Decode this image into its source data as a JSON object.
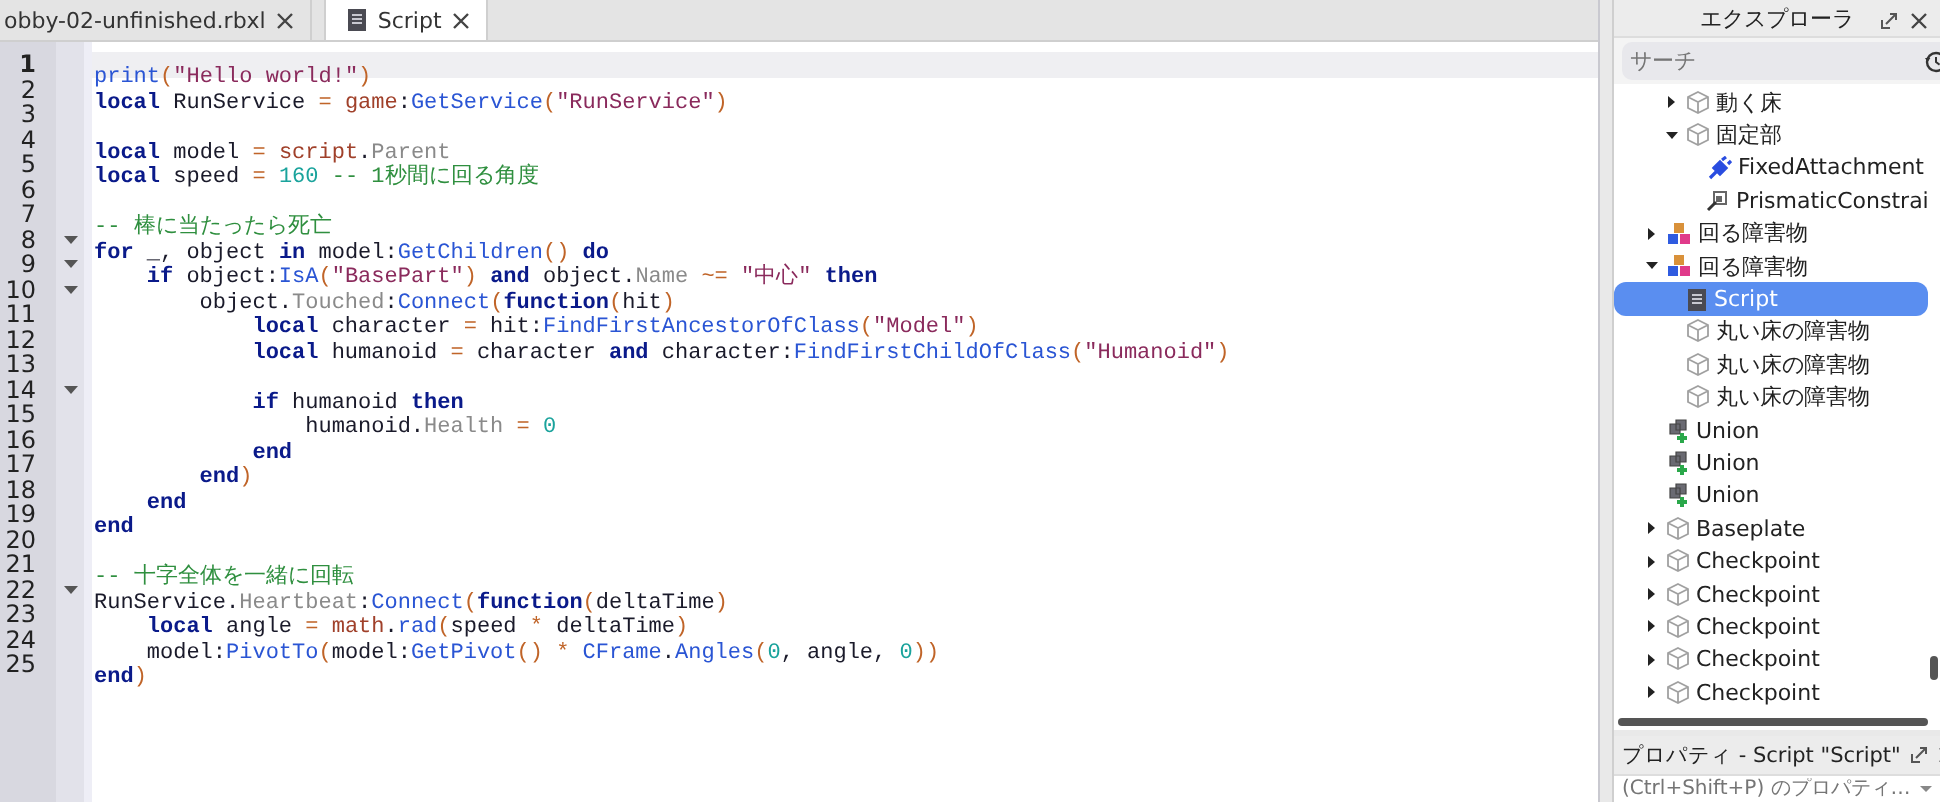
{
  "tabs": [
    {
      "label": "obby-02-unfinished.rbxl",
      "kind": "place",
      "selected": false
    },
    {
      "label": "Script",
      "kind": "script",
      "selected": true
    }
  ],
  "code": {
    "lines": [
      {
        "number": "1",
        "fold": false,
        "current": true,
        "tokens": [
          {
            "kind": "fn",
            "text": "print"
          },
          {
            "kind": "op",
            "text": "("
          },
          {
            "kind": "str",
            "text": "\"Hello world!\""
          },
          {
            "kind": "op",
            "text": ")"
          }
        ]
      },
      {
        "number": "2",
        "fold": false,
        "current": false,
        "tokens": [
          {
            "kind": "kw",
            "text": "local"
          },
          {
            "kind": "pl",
            "text": " RunService "
          },
          {
            "kind": "op",
            "text": "= "
          },
          {
            "kind": "bi",
            "text": "game"
          },
          {
            "kind": "pl",
            "text": ":"
          },
          {
            "kind": "fn",
            "text": "GetService"
          },
          {
            "kind": "op",
            "text": "("
          },
          {
            "kind": "str",
            "text": "\"RunService\""
          },
          {
            "kind": "op",
            "text": ")"
          }
        ]
      },
      {
        "number": "3",
        "fold": false,
        "current": false
      },
      {
        "number": "4",
        "fold": false,
        "current": false,
        "tokens": [
          {
            "kind": "kw",
            "text": "local"
          },
          {
            "kind": "pl",
            "text": " model "
          },
          {
            "kind": "op",
            "text": "= "
          },
          {
            "kind": "bi",
            "text": "script"
          },
          {
            "kind": "pl",
            "text": "."
          },
          {
            "kind": "prop",
            "text": "Parent"
          }
        ]
      },
      {
        "number": "5",
        "fold": false,
        "current": false,
        "tokens": [
          {
            "kind": "kw",
            "text": "local"
          },
          {
            "kind": "pl",
            "text": " speed "
          },
          {
            "kind": "op",
            "text": "= "
          },
          {
            "kind": "num",
            "text": "160"
          },
          {
            "kind": "com",
            "text": " -- 1秒間に回る角度"
          }
        ]
      },
      {
        "number": "6",
        "fold": false,
        "current": false
      },
      {
        "number": "7",
        "fold": false,
        "current": false,
        "tokens": [
          {
            "kind": "com",
            "text": "-- 棒に当たったら死亡"
          }
        ]
      },
      {
        "number": "8",
        "fold": true,
        "current": false,
        "tokens": [
          {
            "kind": "kw",
            "text": "for"
          },
          {
            "kind": "pl",
            "text": " _, object "
          },
          {
            "kind": "kw",
            "text": "in"
          },
          {
            "kind": "pl",
            "text": " model:"
          },
          {
            "kind": "fn",
            "text": "GetChildren"
          },
          {
            "kind": "op",
            "text": "() "
          },
          {
            "kind": "kw",
            "text": "do"
          }
        ]
      },
      {
        "number": "9",
        "fold": true,
        "current": false,
        "tokens": [
          {
            "kind": "kw",
            "text": "    if"
          },
          {
            "kind": "pl",
            "text": " object:"
          },
          {
            "kind": "fn",
            "text": "IsA"
          },
          {
            "kind": "op",
            "text": "("
          },
          {
            "kind": "str",
            "text": "\"BasePart\""
          },
          {
            "kind": "op",
            "text": ") "
          },
          {
            "kind": "kw",
            "text": "and"
          },
          {
            "kind": "pl",
            "text": " object."
          },
          {
            "kind": "prop",
            "text": "Name"
          },
          {
            "kind": "op",
            "text": " ~= "
          },
          {
            "kind": "str",
            "text": "\"中心\" "
          },
          {
            "kind": "kw",
            "text": "then"
          }
        ]
      },
      {
        "number": "10",
        "fold": true,
        "current": false,
        "tokens": [
          {
            "kind": "pl",
            "text": "        object."
          },
          {
            "kind": "prop",
            "text": "Touched"
          },
          {
            "kind": "pl",
            "text": ":"
          },
          {
            "kind": "fn",
            "text": "Connect"
          },
          {
            "kind": "op",
            "text": "("
          },
          {
            "kind": "kw",
            "text": "function"
          },
          {
            "kind": "op",
            "text": "("
          },
          {
            "kind": "pl",
            "text": "hit"
          },
          {
            "kind": "op",
            "text": ")"
          }
        ]
      },
      {
        "number": "11",
        "fold": false,
        "current": false,
        "tokens": [
          {
            "kind": "kw",
            "text": "            local"
          },
          {
            "kind": "pl",
            "text": " character "
          },
          {
            "kind": "op",
            "text": "="
          },
          {
            "kind": "pl",
            "text": " hit:"
          },
          {
            "kind": "fn",
            "text": "FindFirstAncestorOfClass"
          },
          {
            "kind": "op",
            "text": "("
          },
          {
            "kind": "str",
            "text": "\"Model\""
          },
          {
            "kind": "op",
            "text": ")"
          }
        ]
      },
      {
        "number": "12",
        "fold": false,
        "current": false,
        "tokens": [
          {
            "kind": "kw",
            "text": "            local"
          },
          {
            "kind": "pl",
            "text": " humanoid "
          },
          {
            "kind": "op",
            "text": "="
          },
          {
            "kind": "pl",
            "text": " character "
          },
          {
            "kind": "kw",
            "text": "and"
          },
          {
            "kind": "pl",
            "text": " character:"
          },
          {
            "kind": "fn",
            "text": "FindFirstChildOfClass"
          },
          {
            "kind": "op",
            "text": "("
          },
          {
            "kind": "str",
            "text": "\"Humanoid\""
          },
          {
            "kind": "op",
            "text": ")"
          }
        ]
      },
      {
        "number": "13",
        "fold": false,
        "current": false
      },
      {
        "number": "14",
        "fold": true,
        "current": false,
        "tokens": [
          {
            "kind": "kw",
            "text": "            if"
          },
          {
            "kind": "pl",
            "text": " humanoid "
          },
          {
            "kind": "kw",
            "text": "then"
          }
        ]
      },
      {
        "number": "15",
        "fold": false,
        "current": false,
        "tokens": [
          {
            "kind": "pl",
            "text": "                humanoid."
          },
          {
            "kind": "prop",
            "text": "Health"
          },
          {
            "kind": "op",
            "text": " = "
          },
          {
            "kind": "num",
            "text": "0"
          }
        ]
      },
      {
        "number": "16",
        "fold": false,
        "current": false,
        "tokens": [
          {
            "kind": "kw",
            "text": "            end"
          }
        ]
      },
      {
        "number": "17",
        "fold": false,
        "current": false,
        "tokens": [
          {
            "kind": "kw",
            "text": "        end"
          },
          {
            "kind": "op",
            "text": ")"
          }
        ]
      },
      {
        "number": "18",
        "fold": false,
        "current": false,
        "tokens": [
          {
            "kind": "kw",
            "text": "    end"
          }
        ]
      },
      {
        "number": "19",
        "fold": false,
        "current": false,
        "tokens": [
          {
            "kind": "kw",
            "text": "end"
          }
        ]
      },
      {
        "number": "20",
        "fold": false,
        "current": false
      },
      {
        "number": "21",
        "fold": false,
        "current": false,
        "tokens": [
          {
            "kind": "com",
            "text": "-- 十字全体を一緒に回転"
          }
        ]
      },
      {
        "number": "22",
        "fold": true,
        "current": false,
        "tokens": [
          {
            "kind": "pl",
            "text": "RunService."
          },
          {
            "kind": "prop",
            "text": "Heartbeat"
          },
          {
            "kind": "pl",
            "text": ":"
          },
          {
            "kind": "fn",
            "text": "Connect"
          },
          {
            "kind": "op",
            "text": "("
          },
          {
            "kind": "kw",
            "text": "function"
          },
          {
            "kind": "op",
            "text": "("
          },
          {
            "kind": "pl",
            "text": "deltaTime"
          },
          {
            "kind": "op",
            "text": ")"
          }
        ]
      },
      {
        "number": "23",
        "fold": false,
        "current": false,
        "tokens": [
          {
            "kind": "kw",
            "text": "    local"
          },
          {
            "kind": "pl",
            "text": " angle "
          },
          {
            "kind": "op",
            "text": "= "
          },
          {
            "kind": "bi",
            "text": "math"
          },
          {
            "kind": "pl",
            "text": "."
          },
          {
            "kind": "fn",
            "text": "rad"
          },
          {
            "kind": "op",
            "text": "("
          },
          {
            "kind": "pl",
            "text": "speed "
          },
          {
            "kind": "op",
            "text": "*"
          },
          {
            "kind": "pl",
            "text": " deltaTime"
          },
          {
            "kind": "op",
            "text": ")"
          }
        ]
      },
      {
        "number": "24",
        "fold": false,
        "current": false,
        "tokens": [
          {
            "kind": "pl",
            "text": "    model:"
          },
          {
            "kind": "fn",
            "text": "PivotTo"
          },
          {
            "kind": "op",
            "text": "("
          },
          {
            "kind": "pl",
            "text": "model:"
          },
          {
            "kind": "fn",
            "text": "GetPivot"
          },
          {
            "kind": "op",
            "text": "() * "
          },
          {
            "kind": "fn",
            "text": "CFrame"
          },
          {
            "kind": "pl",
            "text": "."
          },
          {
            "kind": "fn",
            "text": "Angles"
          },
          {
            "kind": "op",
            "text": "("
          },
          {
            "kind": "num",
            "text": "0"
          },
          {
            "kind": "pl",
            "text": ", angle, "
          },
          {
            "kind": "num",
            "text": "0"
          },
          {
            "kind": "op",
            "text": "))"
          }
        ]
      },
      {
        "number": "25",
        "fold": false,
        "current": false,
        "tokens": [
          {
            "kind": "kw",
            "text": "end"
          },
          {
            "kind": "op",
            "text": ")"
          }
        ]
      }
    ]
  },
  "explorer": {
    "title": "エクスプローラ",
    "search": {
      "placeholder": "サーチ"
    },
    "continued_items": [
      {
        "label": "動く床",
        "kind": "part",
        "expanded": false,
        "selected": false
      },
      {
        "label": "固定部",
        "kind": "part",
        "expanded": true,
        "selected": false,
        "children": [
          {
            "label": "FixedAttachment",
            "kind": "attachment",
            "selected": false
          },
          {
            "label": "PrismaticConstrai",
            "kind": "constraint",
            "selected": false
          }
        ]
      }
    ],
    "items": [
      {
        "label": "回る障害物",
        "kind": "model",
        "expanded": false,
        "selected": false
      },
      {
        "label": "回る障害物",
        "kind": "model",
        "expanded": true,
        "selected": false,
        "children": [
          {
            "label": "Script",
            "kind": "script",
            "selected": true
          },
          {
            "label": "丸い床の障害物",
            "kind": "part",
            "selected": false
          },
          {
            "label": "丸い床の障害物",
            "kind": "part",
            "selected": false
          },
          {
            "label": "丸い床の障害物",
            "kind": "part",
            "selected": false
          }
        ]
      },
      {
        "label": "Union",
        "kind": "union",
        "selected": false
      },
      {
        "label": "Union",
        "kind": "union",
        "selected": false
      },
      {
        "label": "Union",
        "kind": "union",
        "selected": false
      },
      {
        "label": "Baseplate",
        "kind": "part",
        "expanded": false,
        "selected": false
      },
      {
        "label": "Checkpoint",
        "kind": "part",
        "expanded": false,
        "selected": false
      },
      {
        "label": "Checkpoint",
        "kind": "part",
        "expanded": false,
        "selected": false
      },
      {
        "label": "Checkpoint",
        "kind": "part",
        "expanded": false,
        "selected": false
      },
      {
        "label": "Checkpoint",
        "kind": "part",
        "expanded": false,
        "selected": false
      },
      {
        "label": "Checkpoint",
        "kind": "part",
        "expanded": false,
        "selected": false
      }
    ]
  },
  "properties": {
    "title": "プロパティ - Script \"Script\"",
    "filter": {
      "placeholder": "(Ctrl+Shift+P) のプロパティ…"
    }
  }
}
